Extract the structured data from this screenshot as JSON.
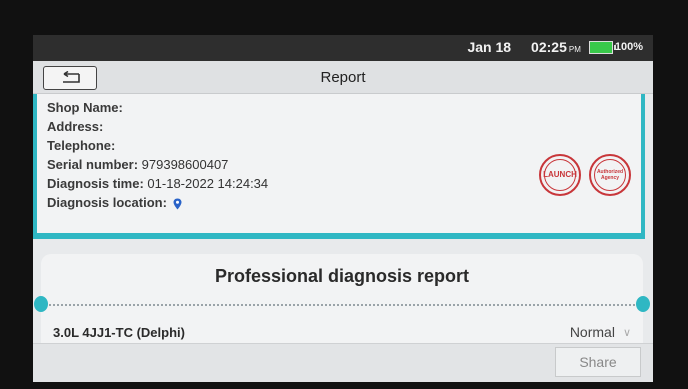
{
  "statusbar": {
    "date": "Jan 18",
    "time": "02:25",
    "ampm": "PM",
    "battery": "100%"
  },
  "header": {
    "title": "Report"
  },
  "info": {
    "shop_name_label": "Shop Name:",
    "address_label": "Address:",
    "telephone_label": "Telephone:",
    "serial_label": "Serial number:",
    "serial_value": "979398600407",
    "diag_time_label": "Diagnosis time:",
    "diag_time_value": "01-18-2022 14:24:34",
    "diag_location_label": "Diagnosis location:"
  },
  "stamps": {
    "left": "LAUNCH",
    "right": "Authorized Agency"
  },
  "report": {
    "title": "Professional diagnosis report",
    "ecu_name": "3.0L 4JJ1-TC (Delphi)",
    "ecu_status": "Normal"
  },
  "footer": {
    "share_label": "Share"
  },
  "colors": {
    "accent": "#2fb7c3",
    "stamp": "#c8363a",
    "battery": "#39c94a"
  },
  "icons": [
    "back-arrow-icon",
    "location-pin-icon",
    "chevron-down-icon",
    "battery-icon"
  ]
}
